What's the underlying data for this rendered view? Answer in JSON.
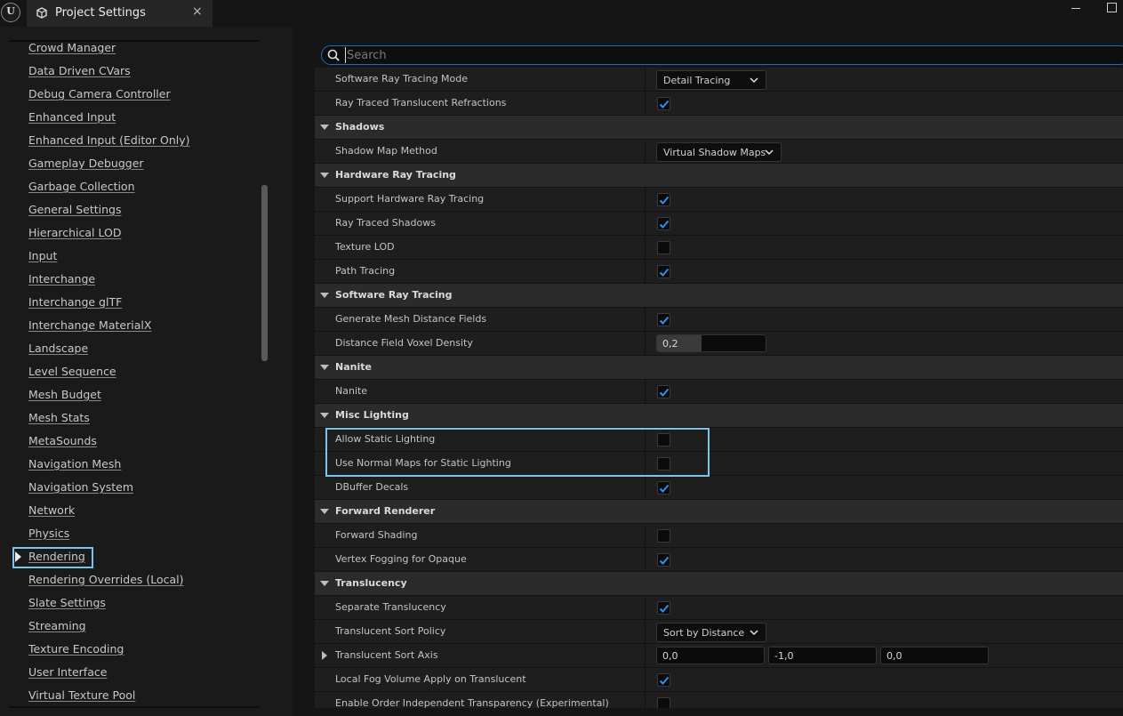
{
  "titlebar": {
    "logo_text": "U",
    "tab_title": "Project Settings",
    "close_glyph": "×"
  },
  "sidebar": {
    "items": [
      {
        "label": "Crowd Manager"
      },
      {
        "label": "Data Driven CVars"
      },
      {
        "label": "Debug Camera Controller"
      },
      {
        "label": "Enhanced Input"
      },
      {
        "label": "Enhanced Input (Editor Only)"
      },
      {
        "label": "Gameplay Debugger"
      },
      {
        "label": "Garbage Collection"
      },
      {
        "label": "General Settings"
      },
      {
        "label": "Hierarchical LOD"
      },
      {
        "label": "Input"
      },
      {
        "label": "Interchange"
      },
      {
        "label": "Interchange glTF"
      },
      {
        "label": "Interchange MaterialX"
      },
      {
        "label": "Landscape"
      },
      {
        "label": "Level Sequence"
      },
      {
        "label": "Mesh Budget"
      },
      {
        "label": "Mesh Stats"
      },
      {
        "label": "MetaSounds"
      },
      {
        "label": "Navigation Mesh"
      },
      {
        "label": "Navigation System"
      },
      {
        "label": "Network"
      },
      {
        "label": "Physics"
      },
      {
        "label": "Rendering",
        "selected": true
      },
      {
        "label": "Rendering Overrides (Local)"
      },
      {
        "label": "Slate Settings"
      },
      {
        "label": "Streaming"
      },
      {
        "label": "Texture Encoding"
      },
      {
        "label": "User Interface"
      },
      {
        "label": "Virtual Texture Pool"
      }
    ]
  },
  "search": {
    "placeholder": "Search",
    "value": ""
  },
  "colors": {
    "accent": "#1a6fc0",
    "highlight": "#7cc4ea",
    "checkmark": "#2f8ff0"
  },
  "properties": [
    {
      "type": "prop",
      "label": "Software Ray Tracing Mode",
      "control": "combo",
      "value": "Detail Tracing"
    },
    {
      "type": "prop",
      "label": "Ray Traced Translucent Refractions",
      "control": "checkbox",
      "checked": true
    },
    {
      "type": "cat",
      "label": "Shadows"
    },
    {
      "type": "prop",
      "label": "Shadow Map Method",
      "control": "combo",
      "value": "Virtual Shadow Maps"
    },
    {
      "type": "cat",
      "label": "Hardware Ray Tracing"
    },
    {
      "type": "prop",
      "label": "Support Hardware Ray Tracing",
      "control": "checkbox",
      "checked": true
    },
    {
      "type": "prop",
      "label": "Ray Traced Shadows",
      "control": "checkbox",
      "checked": true
    },
    {
      "type": "prop",
      "label": "Texture LOD",
      "control": "checkbox",
      "checked": false
    },
    {
      "type": "prop",
      "label": "Path Tracing",
      "control": "checkbox",
      "checked": true
    },
    {
      "type": "cat",
      "label": "Software Ray Tracing"
    },
    {
      "type": "prop",
      "label": "Generate Mesh Distance Fields",
      "control": "checkbox",
      "checked": true
    },
    {
      "type": "prop",
      "label": "Distance Field Voxel Density",
      "control": "slider",
      "value": "0,2",
      "fill_fraction": 0.41
    },
    {
      "type": "cat",
      "label": "Nanite"
    },
    {
      "type": "prop",
      "label": "Nanite",
      "control": "checkbox",
      "checked": true
    },
    {
      "type": "cat",
      "label": "Misc Lighting"
    },
    {
      "type": "prop",
      "label": "Allow Static Lighting",
      "control": "checkbox",
      "checked": false
    },
    {
      "type": "prop",
      "label": "Use Normal Maps for Static Lighting",
      "control": "checkbox",
      "checked": false
    },
    {
      "type": "prop",
      "label": "DBuffer Decals",
      "control": "checkbox",
      "checked": true
    },
    {
      "type": "cat",
      "label": "Forward Renderer"
    },
    {
      "type": "prop",
      "label": "Forward Shading",
      "control": "checkbox",
      "checked": false
    },
    {
      "type": "prop",
      "label": "Vertex Fogging for Opaque",
      "control": "checkbox",
      "checked": true
    },
    {
      "type": "cat",
      "label": "Translucency"
    },
    {
      "type": "prop",
      "label": "Separate Translucency",
      "control": "checkbox",
      "checked": true
    },
    {
      "type": "prop",
      "label": "Translucent Sort Policy",
      "control": "combo",
      "value": "Sort by Distance"
    },
    {
      "type": "prop",
      "label": "Translucent Sort Axis",
      "control": "vector",
      "values": [
        "0,0",
        "-1,0",
        "0,0"
      ],
      "expandable": true
    },
    {
      "type": "prop",
      "label": "Local Fog Volume Apply on Translucent",
      "control": "checkbox",
      "checked": true
    },
    {
      "type": "prop",
      "label": "Enable Order Independent Transparency (Experimental)",
      "control": "checkbox",
      "checked": false
    }
  ]
}
